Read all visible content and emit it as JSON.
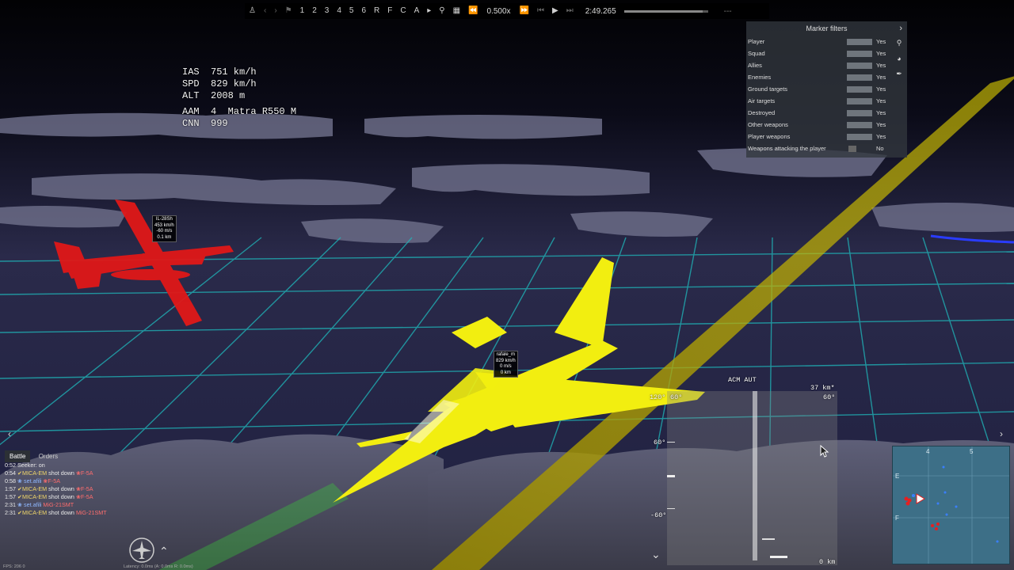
{
  "toolbar": {
    "buttons": [
      "1",
      "2",
      "3",
      "4",
      "5",
      "6",
      "R",
      "F",
      "C",
      "A"
    ],
    "speed": "0.500x",
    "time": "2:49.265",
    "progress": 0.94,
    "end_label": "---"
  },
  "hud": {
    "ias": "IAS  751 km/h",
    "spd": "SPD  829 km/h",
    "alt": "ALT  2008 m",
    "aam": "AAM  4  Matra R550 M",
    "cnn": "CNN  999"
  },
  "marker_filters": {
    "title": "Marker filters",
    "rows": [
      {
        "label": "Player",
        "value": "Yes"
      },
      {
        "label": "Squad",
        "value": "Yes"
      },
      {
        "label": "Allies",
        "value": "Yes"
      },
      {
        "label": "Enemies",
        "value": "Yes"
      },
      {
        "label": "Ground targets",
        "value": "Yes"
      },
      {
        "label": "Air targets",
        "value": "Yes"
      },
      {
        "label": "Destroyed",
        "value": "Yes"
      },
      {
        "label": "Other weapons",
        "value": "Yes"
      },
      {
        "label": "Player weapons",
        "value": "Yes"
      },
      {
        "label": "Weapons attacking the player",
        "value": "No"
      }
    ]
  },
  "enemy_tag": {
    "l1": "IL-28Sh",
    "l2": "453 km/h",
    "l3": "-60 m/s",
    "l4": "0.1 km"
  },
  "player_tag": {
    "l1": "rafale_m",
    "l2": "829 km/h",
    "l3": "0 m/s",
    "l4": "0 km"
  },
  "radar": {
    "mode": "ACM AUT",
    "range": "37 km*",
    "left_top": "120°",
    "small_top": "60°",
    "right_top": "60°",
    "mid": "60°",
    "low": "-60°",
    "bottom_range": "0 km"
  },
  "chat": {
    "tabs": [
      "Battle",
      "Orders"
    ],
    "lines": [
      {
        "time": "0:52",
        "a": "Seeker: on",
        "b": "",
        "c": ""
      },
      {
        "time": "0:54",
        "a": "✔MICA-EM",
        "b": " shot down ",
        "c": "❀F-5A"
      },
      {
        "time": "0:58",
        "a": "❀ set.afili",
        "b": "",
        "c": " ❀F-5A"
      },
      {
        "time": "1:57",
        "a": "✔MICA-EM",
        "b": " shot down ",
        "c": "❀F-5A"
      },
      {
        "time": "1:57",
        "a": "✔MICA-EM",
        "b": " shot down ",
        "c": "❀F-5A"
      },
      {
        "time": "2:31",
        "a": "❀ set.afili",
        "b": "",
        "c": " MiG-21SMT"
      },
      {
        "time": "2:31",
        "a": "✔MICA-EM",
        "b": " shot down ",
        "c": "MiG-21SMT"
      }
    ]
  },
  "minimap": {
    "col_a": "4",
    "col_b": "5",
    "row_a": "E",
    "row_b": "F"
  },
  "footer": {
    "fps": "FPS: 206   0",
    "latency": "Latency: 0.0ms (A: 0.0ms R: 0.0ms)"
  },
  "colors": {
    "player": "#f5f000",
    "enemy": "#ff1a1a",
    "grid": "#20c6c6",
    "trail": "#c8b000"
  }
}
